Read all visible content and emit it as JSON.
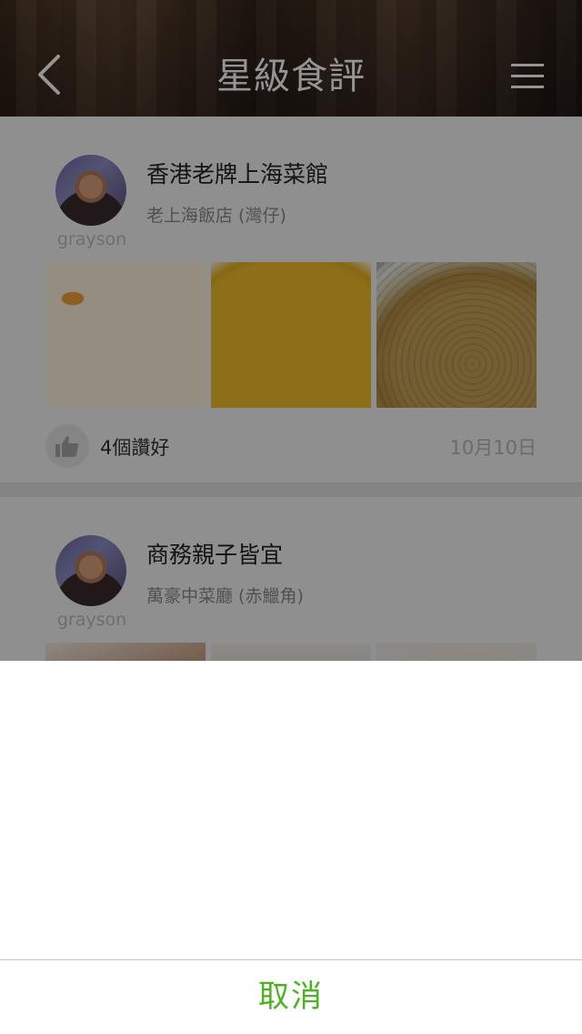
{
  "header": {
    "title": "星級食評",
    "back_icon": "chevron-left-icon",
    "menu_icon": "hamburger-menu-icon"
  },
  "reviews": [
    {
      "username": "grayson",
      "title": "香港老牌上海菜館",
      "restaurant": "老上海飯店 (灣仔)",
      "likes": "4個讚好",
      "date": "10月10日"
    },
    {
      "username": "grayson",
      "title": "商務親子皆宜",
      "restaurant": "萬豪中菜廳 (赤鱲角)"
    }
  ],
  "sheet": {
    "cancel_label": "取消"
  },
  "colors": {
    "accent_green": "#4cb320",
    "overlay": "rgba(0,0,0,0.42)"
  }
}
